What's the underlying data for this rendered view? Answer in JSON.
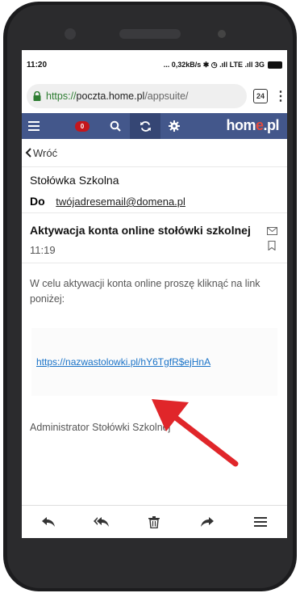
{
  "status": {
    "time": "11:20",
    "indicators": "... 0,32kB/s ✱ ◷ .ıll LTE .ıll 3G"
  },
  "browser": {
    "url_scheme": "https://",
    "url_host": "poczta.home.pl",
    "url_path": "/appsuite/",
    "tab_count": "24",
    "menu_icon": "kebab-icon"
  },
  "appbar": {
    "unread_badge": "0",
    "logo_text": "hom",
    "logo_dot": "e",
    "logo_suffix": ".pl",
    "colors": {
      "bar": "#43578b",
      "badge": "#c4161c",
      "logo_accent": "#e64b3c"
    }
  },
  "nav": {
    "back_label": "Wróć"
  },
  "message": {
    "sender": "Stołówka Szkolna",
    "to_label": "Do",
    "to_address": "twójadresemail@domena.pl",
    "subject": "Aktywacja konta online stołówki szkolnej",
    "time": "11:19",
    "body_text": "W celu aktywacji konta online proszę kliknąć na link poniżej:",
    "link_text": "https://nazwastolowki.pl/hY6TgfR$ejHnA",
    "signature": "Administrator Stołówki Szkolnej"
  },
  "toolbar": {
    "icons": [
      "reply-icon",
      "reply-all-icon",
      "delete-icon",
      "forward-icon",
      "more-menu-icon"
    ]
  },
  "annotation": {
    "arrow_color": "#e0262a"
  }
}
